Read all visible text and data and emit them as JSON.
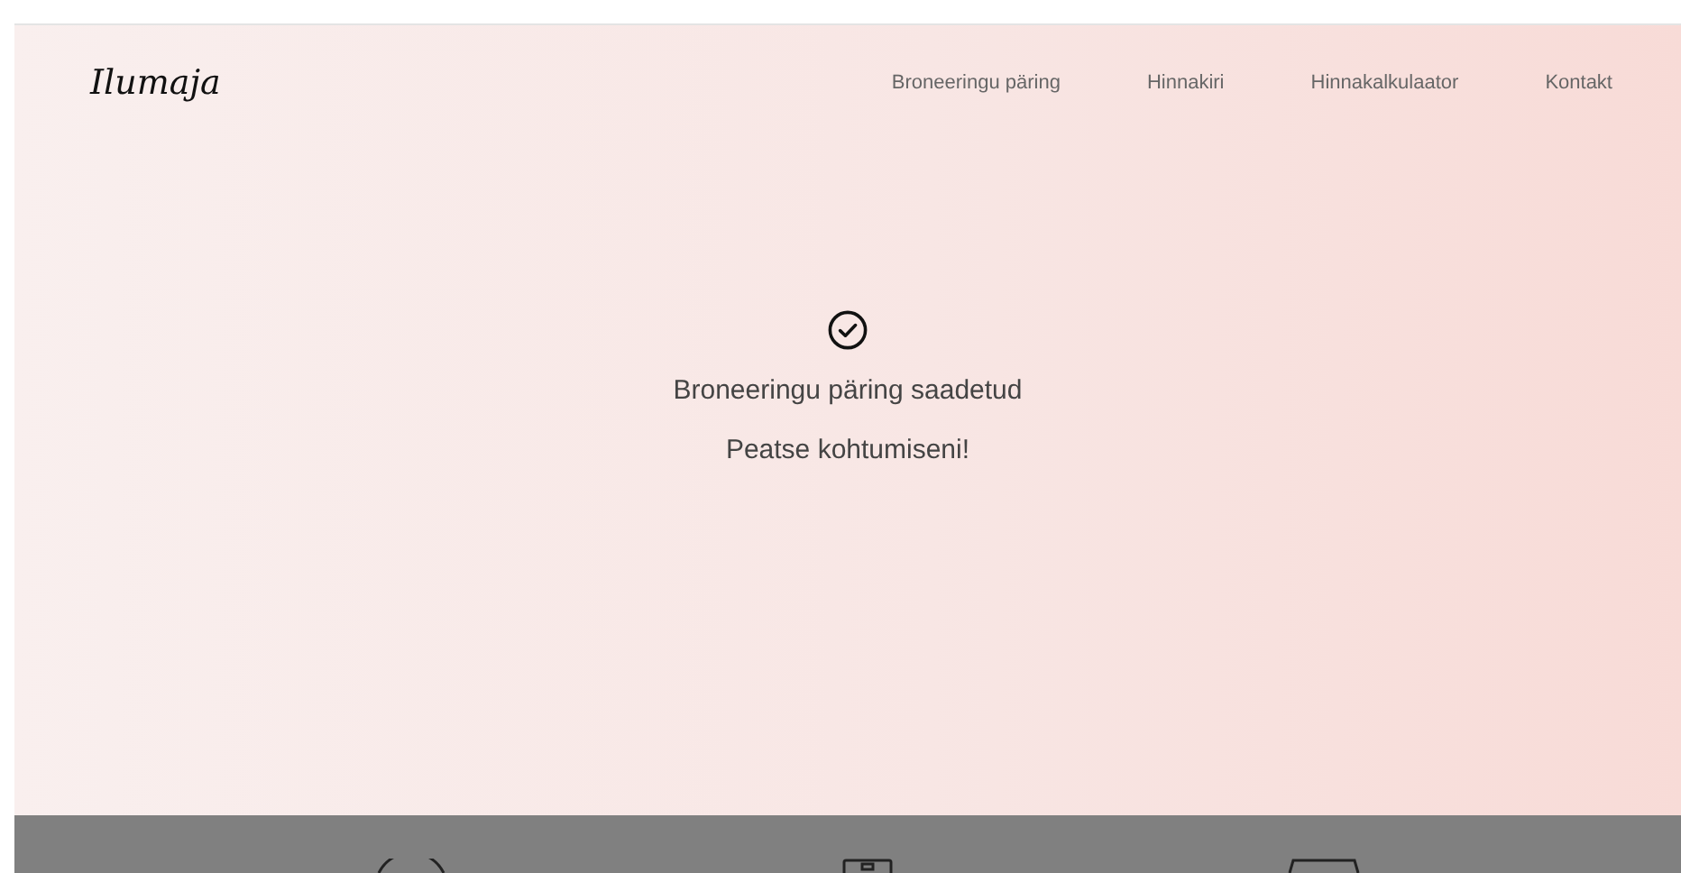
{
  "header": {
    "logo": "Ilumaja",
    "nav": [
      {
        "label": "Broneeringu päring"
      },
      {
        "label": "Hinnakiri"
      },
      {
        "label": "Hinnakalkulaator"
      },
      {
        "label": "Kontakt"
      }
    ]
  },
  "confirmation": {
    "title": "Broneeringu päring saadetud",
    "message": "Peatse kohtumiseni!"
  }
}
